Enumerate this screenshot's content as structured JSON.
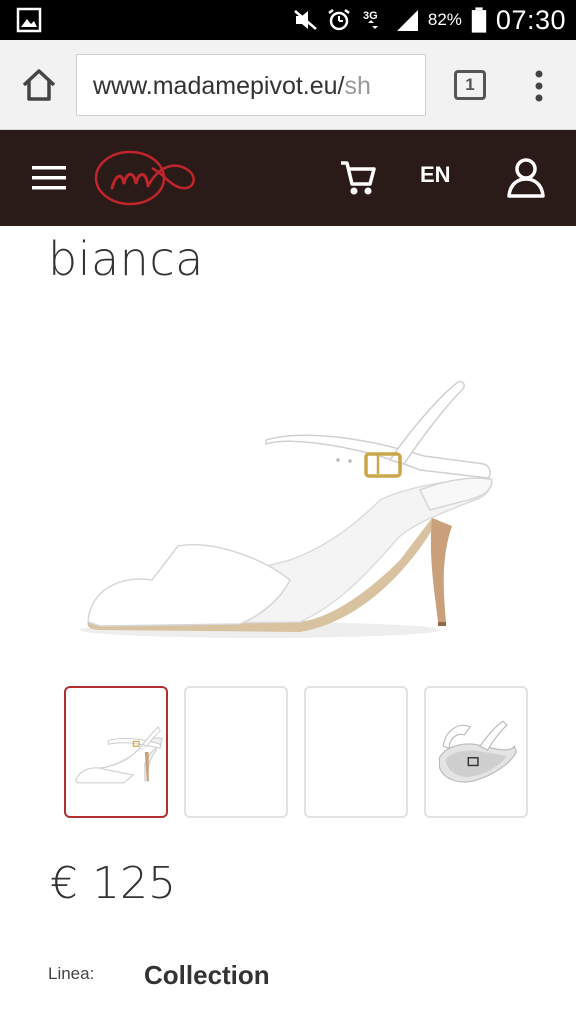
{
  "status_bar": {
    "icons": [
      "gallery-icon",
      "mute-icon",
      "alarm-icon",
      "network-3g-icon",
      "signal-icon",
      "battery-icon"
    ],
    "network": "3G",
    "battery": "82%",
    "time": "07:30"
  },
  "browser": {
    "url_main": "www.madamepivot.eu/",
    "url_dim": "sh",
    "tab_count": "1"
  },
  "header": {
    "language": "EN"
  },
  "product": {
    "title": "bianca",
    "price_currency": "€",
    "price_value": "125",
    "linea_label": "Linea:",
    "linea_value": "Collection",
    "thumbnails": [
      {
        "state": "active"
      },
      {
        "state": "empty"
      },
      {
        "state": "empty"
      },
      {
        "state": "image"
      }
    ]
  },
  "colors": {
    "header_bg": "#2a1a18",
    "logo_red": "#c0252b",
    "active_thumb_border": "#b03030"
  }
}
